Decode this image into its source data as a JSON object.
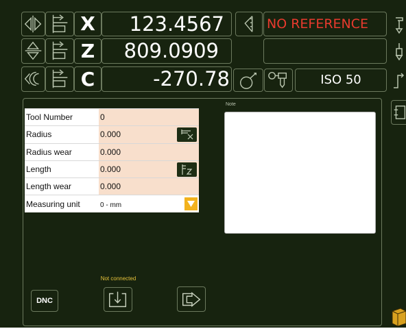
{
  "axes": [
    {
      "letter": "X",
      "value": "123.4567"
    },
    {
      "letter": "Z",
      "value": "809.0909"
    },
    {
      "letter": "C",
      "value": "-270.78"
    }
  ],
  "status": {
    "reference": "NO REFERENCE"
  },
  "spindle": {
    "taper": "ISO 50"
  },
  "tool_table": {
    "rows": [
      {
        "label": "Tool Number",
        "value": "0"
      },
      {
        "label": "Radius",
        "value": "0.000"
      },
      {
        "label": "Radius wear",
        "value": "0.000"
      },
      {
        "label": "Length",
        "value": "0.000"
      },
      {
        "label": "Length wear",
        "value": "0.000"
      },
      {
        "label": "Measuring unit",
        "value": "0 - mm"
      }
    ]
  },
  "note": {
    "label": "Note",
    "text": ""
  },
  "connection": {
    "status": "Not connected"
  },
  "buttons": {
    "dnc_label": "DNC"
  },
  "colors": {
    "background": "#17230f",
    "border": "#6c7a5e",
    "status_red": "#e83a2e",
    "field_peach": "#f8dfcc",
    "dropdown_amber": "#f2b21d",
    "connection_yellow": "#e6c23a"
  },
  "icons": [
    "axis-x-arrows-icon",
    "tool-offset-icon",
    "axis-z-arrows-icon",
    "axis-c-rotation-icon",
    "c-axis-index-icon",
    "c-axis-orient-icon",
    "spindle-tool-icon",
    "reference-scale-icon",
    "radius-measure-icon",
    "length-measure-icon",
    "import-icon",
    "export-icon",
    "tool-change-icon",
    "magazine-icon"
  ]
}
